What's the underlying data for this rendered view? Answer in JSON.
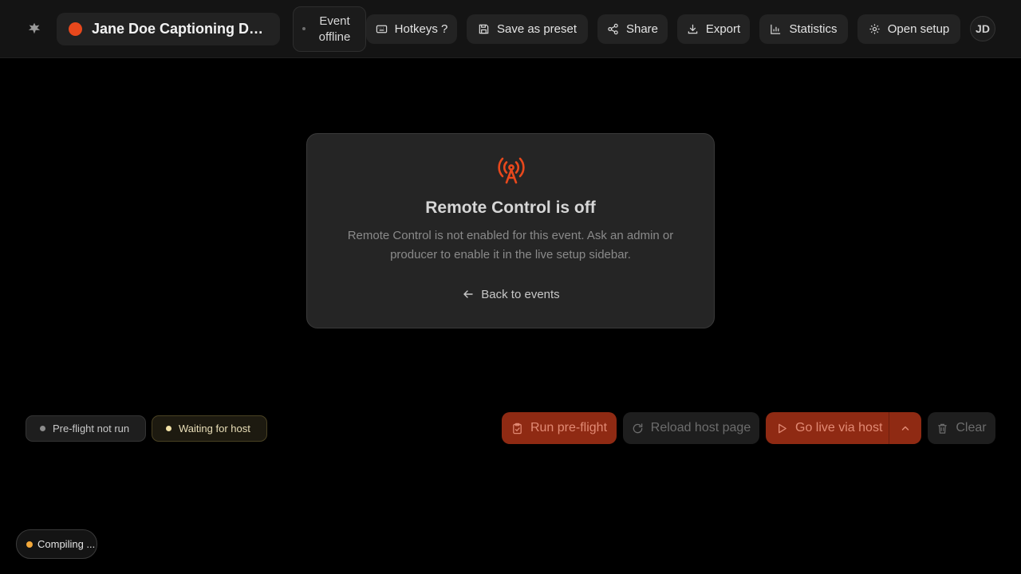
{
  "header": {
    "title": "Jane Doe Captioning Dem...",
    "status": "Event offline",
    "buttons": {
      "hotkeys": "Hotkeys ?",
      "save_preset": "Save as preset",
      "share": "Share",
      "export": "Export",
      "statistics": "Statistics",
      "open_setup": "Open setup"
    },
    "avatar_initials": "JD"
  },
  "notice": {
    "icon": "broadcast-tower-icon",
    "title": "Remote Control is off",
    "description": "Remote Control is not enabled for this event. Ask an admin or producer to enable it in the live setup sidebar.",
    "back_link": "Back to events"
  },
  "status_chips": {
    "preflight": "Pre-flight not run",
    "host": "Waiting for host"
  },
  "actions": {
    "run_preflight": "Run pre-flight",
    "reload_host": "Reload host page",
    "go_live": "Go live via host",
    "clear": "Clear"
  },
  "footer": {
    "compiling": "Compiling ..."
  },
  "colors": {
    "accent": "#e8481c",
    "danger_button_bg": "#8f2a13",
    "warning_dot": "#f2a83a"
  }
}
